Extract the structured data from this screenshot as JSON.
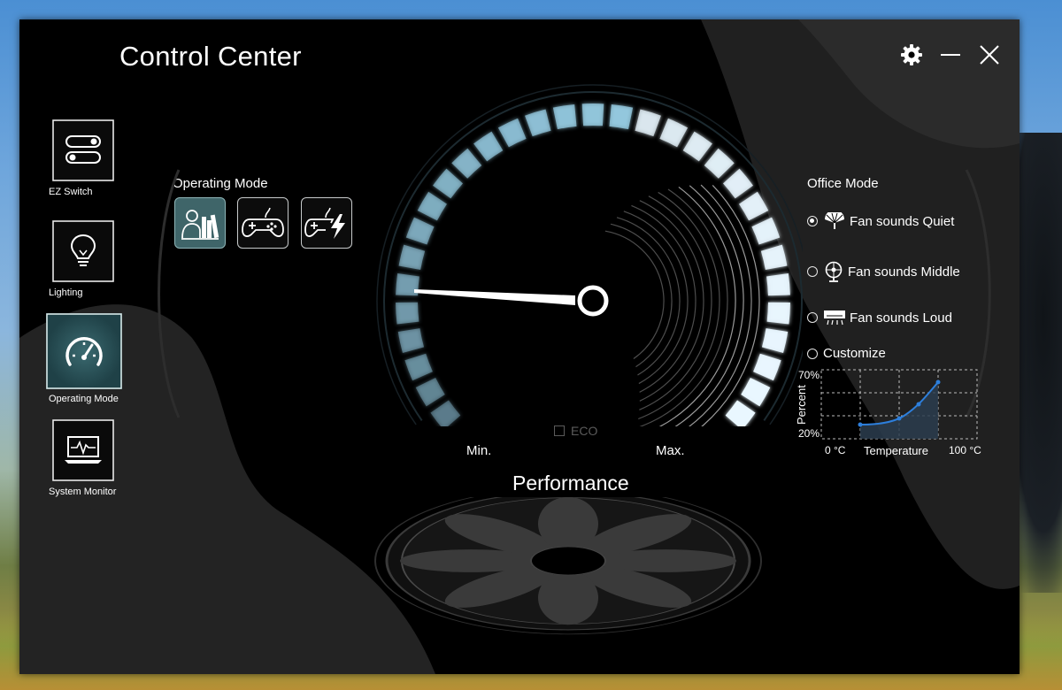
{
  "window": {
    "title": "Control Center"
  },
  "sidebar": {
    "items": [
      {
        "label": "EZ Switch",
        "icon": "toggle-switches-icon",
        "active": false
      },
      {
        "label": "Lighting",
        "icon": "lightbulb-icon",
        "active": false
      },
      {
        "label": "Operating Mode",
        "icon": "speedometer-icon",
        "active": true
      },
      {
        "label": "System Monitor",
        "icon": "laptop-monitor-icon",
        "active": false
      }
    ]
  },
  "operating_mode": {
    "label": "Operating Mode",
    "modes": [
      {
        "icon": "office-reading-icon",
        "selected": true
      },
      {
        "icon": "gamepad-icon",
        "selected": false
      },
      {
        "icon": "gamepad-turbo-icon",
        "selected": false
      }
    ]
  },
  "gauge": {
    "min_label": "Min.",
    "max_label": "Max.",
    "eco_label": "ECO",
    "eco_checked": false,
    "mode_title": "Performance",
    "accent": "#9fd8f0"
  },
  "office_mode": {
    "label": "Office Mode",
    "options": [
      {
        "label": "Fan sounds Quiet",
        "icon": "hand-fan-icon",
        "checked": true
      },
      {
        "label": "Fan sounds Middle",
        "icon": "desk-fan-icon",
        "checked": false
      },
      {
        "label": "Fan sounds Loud",
        "icon": "air-conditioner-icon",
        "checked": false
      },
      {
        "label": "Customize",
        "checked": false
      }
    ],
    "curve": {
      "y_label": "Percent",
      "y_max_label": "70%",
      "y_min_label": "20%",
      "x_min_label": "0 °C",
      "x_label": "Temperature",
      "x_max_label": "100 °C",
      "line_color": "#2d7fdc"
    }
  }
}
